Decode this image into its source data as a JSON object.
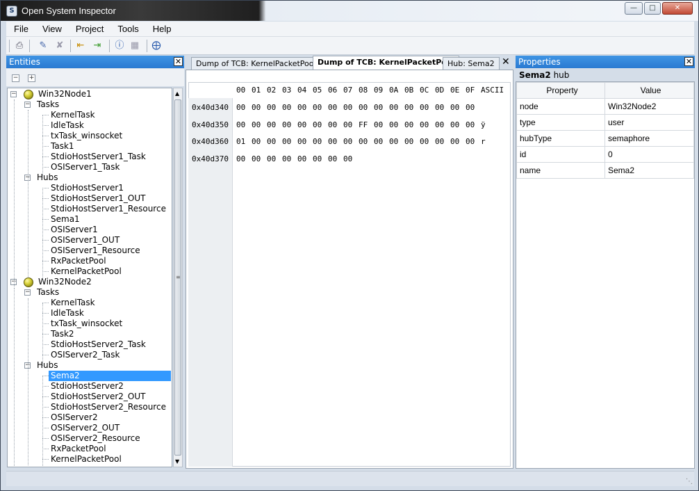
{
  "window": {
    "title": "Open System Inspector"
  },
  "menu": [
    "File",
    "View",
    "Project",
    "Tools",
    "Help"
  ],
  "entities": {
    "title": "Entities",
    "tree": [
      {
        "label": "Win32Node1",
        "level": 0
      },
      {
        "label": "Tasks",
        "level": 1
      },
      {
        "label": "KernelTask",
        "level": 2
      },
      {
        "label": "IdleTask",
        "level": 2
      },
      {
        "label": "txTask_winsocket",
        "level": 2
      },
      {
        "label": "Task1",
        "level": 2
      },
      {
        "label": "StdioHostServer1_Task",
        "level": 2
      },
      {
        "label": "OSIServer1_Task",
        "level": 2
      },
      {
        "label": "Hubs",
        "level": 1
      },
      {
        "label": "StdioHostServer1",
        "level": 2
      },
      {
        "label": "StdioHostServer1_OUT",
        "level": 2
      },
      {
        "label": "StdioHostServer1_Resource",
        "level": 2
      },
      {
        "label": "Sema1",
        "level": 2
      },
      {
        "label": "OSIServer1",
        "level": 2
      },
      {
        "label": "OSIServer1_OUT",
        "level": 2
      },
      {
        "label": "OSIServer1_Resource",
        "level": 2
      },
      {
        "label": "RxPacketPool",
        "level": 2
      },
      {
        "label": "KernelPacketPool",
        "level": 2
      },
      {
        "label": "Win32Node2",
        "level": 0
      },
      {
        "label": "Tasks",
        "level": 1
      },
      {
        "label": "KernelTask",
        "level": 2
      },
      {
        "label": "IdleTask",
        "level": 2
      },
      {
        "label": "txTask_winsocket",
        "level": 2
      },
      {
        "label": "Task2",
        "level": 2
      },
      {
        "label": "StdioHostServer2_Task",
        "level": 2
      },
      {
        "label": "OSIServer2_Task",
        "level": 2
      },
      {
        "label": "Hubs",
        "level": 1
      },
      {
        "label": "Sema2",
        "level": 2,
        "selected": true
      },
      {
        "label": "StdioHostServer2",
        "level": 2
      },
      {
        "label": "StdioHostServer2_OUT",
        "level": 2
      },
      {
        "label": "StdioHostServer2_Resource",
        "level": 2
      },
      {
        "label": "OSIServer2",
        "level": 2
      },
      {
        "label": "OSIServer2_OUT",
        "level": 2
      },
      {
        "label": "OSIServer2_Resource",
        "level": 2
      },
      {
        "label": "RxPacketPool",
        "level": 2
      },
      {
        "label": "KernelPacketPool",
        "level": 2
      }
    ]
  },
  "tabs": [
    {
      "label": "Dump of TCB: KernelPacketPool",
      "active": false
    },
    {
      "label": "Dump of TCB: KernelPacketPool",
      "active": true
    },
    {
      "label": "Hub: Sema2",
      "active": false
    }
  ],
  "dump": {
    "columns": [
      "00",
      "01",
      "02",
      "03",
      "04",
      "05",
      "06",
      "07",
      "08",
      "09",
      "0A",
      "0B",
      "0C",
      "0D",
      "0E",
      "0F",
      "ASCII"
    ],
    "rows": [
      {
        "addr": "0x40d340",
        "bytes": [
          "00",
          "00",
          "00",
          "00",
          "00",
          "00",
          "00",
          "00",
          "00",
          "00",
          "00",
          "00",
          "00",
          "00",
          "00",
          "00"
        ],
        "ascii": ""
      },
      {
        "addr": "0x40d350",
        "bytes": [
          "00",
          "00",
          "00",
          "00",
          "00",
          "00",
          "00",
          "00",
          "FF",
          "00",
          "00",
          "00",
          "00",
          "00",
          "00",
          "00"
        ],
        "ascii": "ÿ"
      },
      {
        "addr": "0x40d360",
        "bytes": [
          "01",
          "00",
          "00",
          "00",
          "00",
          "00",
          "00",
          "00",
          "00",
          "00",
          "00",
          "00",
          "00",
          "00",
          "00",
          "00"
        ],
        "ascii": "r"
      },
      {
        "addr": "0x40d370",
        "bytes": [
          "00",
          "00",
          "00",
          "00",
          "00",
          "00",
          "00",
          "00"
        ],
        "ascii": ""
      }
    ]
  },
  "properties": {
    "title": "Properties",
    "subject": "Sema2",
    "subject_kind": "hub",
    "col_property": "Property",
    "col_value": "Value",
    "rows": [
      {
        "key": "node",
        "value": "Win32Node2"
      },
      {
        "key": "type",
        "value": "user"
      },
      {
        "key": "hubType",
        "value": "semaphore"
      },
      {
        "key": "id",
        "value": "0"
      },
      {
        "key": "name",
        "value": "Sema2"
      }
    ]
  },
  "colors": {
    "accent": "#3399ff",
    "panel_header": "#2a7ad2"
  }
}
